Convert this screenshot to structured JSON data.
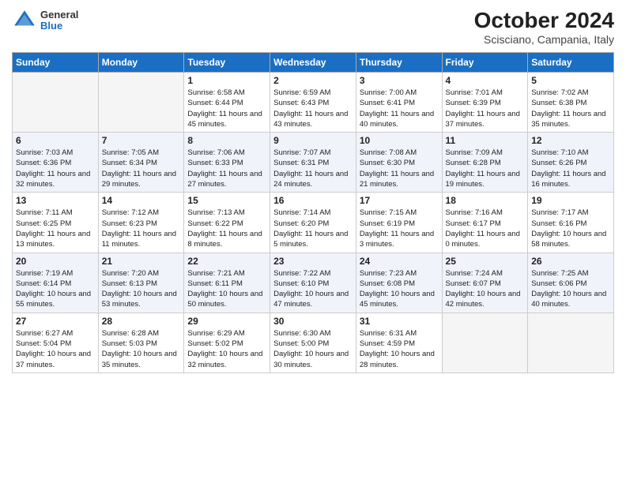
{
  "header": {
    "logo": {
      "general": "General",
      "blue": "Blue"
    },
    "title": "October 2024",
    "subtitle": "Scisciano, Campania, Italy"
  },
  "weekdays": [
    "Sunday",
    "Monday",
    "Tuesday",
    "Wednesday",
    "Thursday",
    "Friday",
    "Saturday"
  ],
  "weeks": [
    [
      {
        "day": "",
        "empty": true
      },
      {
        "day": "",
        "empty": true
      },
      {
        "day": "1",
        "sunrise": "Sunrise: 6:58 AM",
        "sunset": "Sunset: 6:44 PM",
        "daylight": "Daylight: 11 hours and 45 minutes."
      },
      {
        "day": "2",
        "sunrise": "Sunrise: 6:59 AM",
        "sunset": "Sunset: 6:43 PM",
        "daylight": "Daylight: 11 hours and 43 minutes."
      },
      {
        "day": "3",
        "sunrise": "Sunrise: 7:00 AM",
        "sunset": "Sunset: 6:41 PM",
        "daylight": "Daylight: 11 hours and 40 minutes."
      },
      {
        "day": "4",
        "sunrise": "Sunrise: 7:01 AM",
        "sunset": "Sunset: 6:39 PM",
        "daylight": "Daylight: 11 hours and 37 minutes."
      },
      {
        "day": "5",
        "sunrise": "Sunrise: 7:02 AM",
        "sunset": "Sunset: 6:38 PM",
        "daylight": "Daylight: 11 hours and 35 minutes."
      }
    ],
    [
      {
        "day": "6",
        "sunrise": "Sunrise: 7:03 AM",
        "sunset": "Sunset: 6:36 PM",
        "daylight": "Daylight: 11 hours and 32 minutes."
      },
      {
        "day": "7",
        "sunrise": "Sunrise: 7:05 AM",
        "sunset": "Sunset: 6:34 PM",
        "daylight": "Daylight: 11 hours and 29 minutes."
      },
      {
        "day": "8",
        "sunrise": "Sunrise: 7:06 AM",
        "sunset": "Sunset: 6:33 PM",
        "daylight": "Daylight: 11 hours and 27 minutes."
      },
      {
        "day": "9",
        "sunrise": "Sunrise: 7:07 AM",
        "sunset": "Sunset: 6:31 PM",
        "daylight": "Daylight: 11 hours and 24 minutes."
      },
      {
        "day": "10",
        "sunrise": "Sunrise: 7:08 AM",
        "sunset": "Sunset: 6:30 PM",
        "daylight": "Daylight: 11 hours and 21 minutes."
      },
      {
        "day": "11",
        "sunrise": "Sunrise: 7:09 AM",
        "sunset": "Sunset: 6:28 PM",
        "daylight": "Daylight: 11 hours and 19 minutes."
      },
      {
        "day": "12",
        "sunrise": "Sunrise: 7:10 AM",
        "sunset": "Sunset: 6:26 PM",
        "daylight": "Daylight: 11 hours and 16 minutes."
      }
    ],
    [
      {
        "day": "13",
        "sunrise": "Sunrise: 7:11 AM",
        "sunset": "Sunset: 6:25 PM",
        "daylight": "Daylight: 11 hours and 13 minutes."
      },
      {
        "day": "14",
        "sunrise": "Sunrise: 7:12 AM",
        "sunset": "Sunset: 6:23 PM",
        "daylight": "Daylight: 11 hours and 11 minutes."
      },
      {
        "day": "15",
        "sunrise": "Sunrise: 7:13 AM",
        "sunset": "Sunset: 6:22 PM",
        "daylight": "Daylight: 11 hours and 8 minutes."
      },
      {
        "day": "16",
        "sunrise": "Sunrise: 7:14 AM",
        "sunset": "Sunset: 6:20 PM",
        "daylight": "Daylight: 11 hours and 5 minutes."
      },
      {
        "day": "17",
        "sunrise": "Sunrise: 7:15 AM",
        "sunset": "Sunset: 6:19 PM",
        "daylight": "Daylight: 11 hours and 3 minutes."
      },
      {
        "day": "18",
        "sunrise": "Sunrise: 7:16 AM",
        "sunset": "Sunset: 6:17 PM",
        "daylight": "Daylight: 11 hours and 0 minutes."
      },
      {
        "day": "19",
        "sunrise": "Sunrise: 7:17 AM",
        "sunset": "Sunset: 6:16 PM",
        "daylight": "Daylight: 10 hours and 58 minutes."
      }
    ],
    [
      {
        "day": "20",
        "sunrise": "Sunrise: 7:19 AM",
        "sunset": "Sunset: 6:14 PM",
        "daylight": "Daylight: 10 hours and 55 minutes."
      },
      {
        "day": "21",
        "sunrise": "Sunrise: 7:20 AM",
        "sunset": "Sunset: 6:13 PM",
        "daylight": "Daylight: 10 hours and 53 minutes."
      },
      {
        "day": "22",
        "sunrise": "Sunrise: 7:21 AM",
        "sunset": "Sunset: 6:11 PM",
        "daylight": "Daylight: 10 hours and 50 minutes."
      },
      {
        "day": "23",
        "sunrise": "Sunrise: 7:22 AM",
        "sunset": "Sunset: 6:10 PM",
        "daylight": "Daylight: 10 hours and 47 minutes."
      },
      {
        "day": "24",
        "sunrise": "Sunrise: 7:23 AM",
        "sunset": "Sunset: 6:08 PM",
        "daylight": "Daylight: 10 hours and 45 minutes."
      },
      {
        "day": "25",
        "sunrise": "Sunrise: 7:24 AM",
        "sunset": "Sunset: 6:07 PM",
        "daylight": "Daylight: 10 hours and 42 minutes."
      },
      {
        "day": "26",
        "sunrise": "Sunrise: 7:25 AM",
        "sunset": "Sunset: 6:06 PM",
        "daylight": "Daylight: 10 hours and 40 minutes."
      }
    ],
    [
      {
        "day": "27",
        "sunrise": "Sunrise: 6:27 AM",
        "sunset": "Sunset: 5:04 PM",
        "daylight": "Daylight: 10 hours and 37 minutes."
      },
      {
        "day": "28",
        "sunrise": "Sunrise: 6:28 AM",
        "sunset": "Sunset: 5:03 PM",
        "daylight": "Daylight: 10 hours and 35 minutes."
      },
      {
        "day": "29",
        "sunrise": "Sunrise: 6:29 AM",
        "sunset": "Sunset: 5:02 PM",
        "daylight": "Daylight: 10 hours and 32 minutes."
      },
      {
        "day": "30",
        "sunrise": "Sunrise: 6:30 AM",
        "sunset": "Sunset: 5:00 PM",
        "daylight": "Daylight: 10 hours and 30 minutes."
      },
      {
        "day": "31",
        "sunrise": "Sunrise: 6:31 AM",
        "sunset": "Sunset: 4:59 PM",
        "daylight": "Daylight: 10 hours and 28 minutes."
      },
      {
        "day": "",
        "empty": true
      },
      {
        "day": "",
        "empty": true
      }
    ]
  ]
}
